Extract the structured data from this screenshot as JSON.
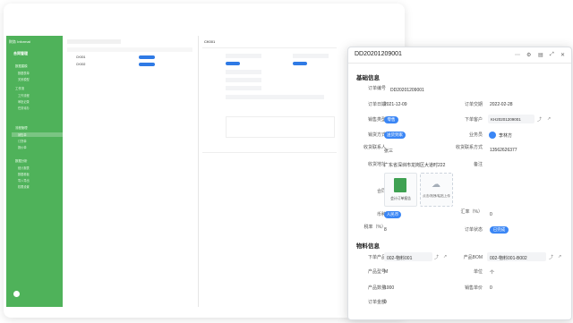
{
  "app": {
    "brand": "财务 Informat",
    "workspace": "合同管理"
  },
  "sidebar": {
    "groups": [
      {
        "label": "数据建模",
        "items": [
          "数据表单",
          "关系模型"
        ]
      },
      {
        "label": "工作流",
        "items": [
          "工作流程",
          "审批记录",
          "任务待办"
        ]
      },
      {
        "label": "流程管理",
        "items": [
          "销售单",
          "订货单",
          "报价单"
        ]
      },
      {
        "label": "数据分析",
        "items": [
          "统计报表",
          "数据看板",
          "导入导出",
          "权限设置"
        ]
      }
    ]
  },
  "list": {
    "rows": [
      {
        "id": "CK001",
        "tag": "已审批"
      },
      {
        "id": "CK002",
        "tag": "已审批"
      }
    ]
  },
  "background_detail": {
    "title": "CK001"
  },
  "record": {
    "title": "DD20201209001",
    "base_section": "基础信息",
    "fields": {
      "order_no_label": "订单编号",
      "order_no": "DD20201209001",
      "order_date_label": "订单日期",
      "order_date": "2021-12-09",
      "deadline_label": "订单交期",
      "deadline": "2022-02-28",
      "sales_type_label": "销售类型",
      "sales_type": "零售",
      "customer_label": "下单客户",
      "customer": "KH20201209001",
      "ship_label": "销货方式",
      "ship": "送货到家",
      "sales_label": "业务员",
      "sales": "李林方",
      "contact_label": "收货联系人",
      "contact": "张三",
      "phone_label": "收货联系方式",
      "phone": "13562626377",
      "address_label": "收货地址",
      "address": "广东省深圳市龙岗区大道时222",
      "remark_label": "备注",
      "contract_label": "合同",
      "contract_file": "会计订单报告",
      "upload_text": "点击/拖拽/粘贴上传",
      "currency_label": "币种",
      "currency": "人民币",
      "rate_label": "汇率（%）",
      "rate": "0",
      "tax_label": "税率（%）",
      "tax": "8",
      "status_label": "订单状态",
      "status": "已完成"
    },
    "material_section": "物料信息",
    "material": {
      "item_label": "下单产品",
      "item": "002-物料001",
      "bom_label": "产品BOM",
      "bom": "002-物料001-B002",
      "model_label": "产品型号",
      "model": "M",
      "unit_label": "单位",
      "unit": "个",
      "qty_label": "产品数量",
      "qty": "1000",
      "price_label": "销售单价",
      "price": "0",
      "amount_label": "订单金额",
      "amount": "0"
    }
  },
  "colors": {
    "sidebar": "#4fb25a",
    "accent": "#3a86f5",
    "dot_red": "#f25f58",
    "dot_yellow": "#f9be2f",
    "dot_green": "#3bc54e"
  }
}
